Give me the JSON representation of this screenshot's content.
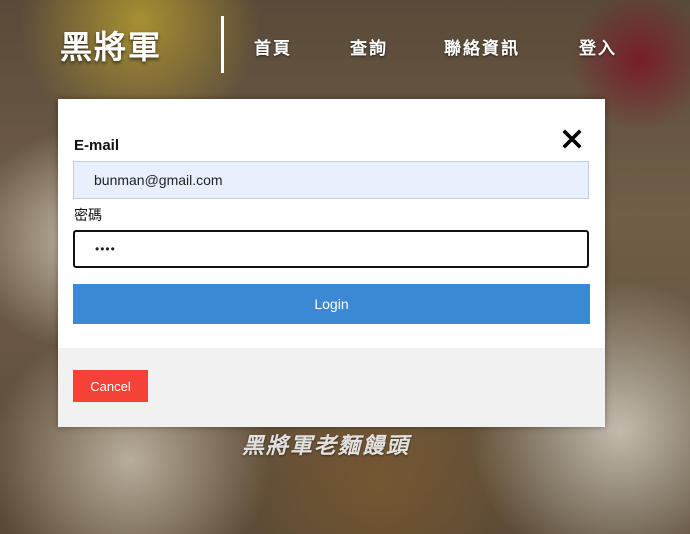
{
  "nav": {
    "brand": "黑將軍",
    "items": [
      {
        "label": "首頁"
      },
      {
        "label": "查詢"
      },
      {
        "label": "聯絡資訊"
      },
      {
        "label": "登入"
      }
    ]
  },
  "hero": {
    "watermark": "黑將軍老麵饅頭"
  },
  "login_modal": {
    "email_label": "E-mail",
    "email_value": "bunman@gmail.com",
    "password_label": "密碼",
    "password_value": "••••",
    "login_label": "Login",
    "cancel_label": "Cancel",
    "close_icon": "close-icon"
  },
  "colors": {
    "login_button": "#3b88d4",
    "cancel_button": "#f44336",
    "email_autofill_bg": "#e8f0fe",
    "footer_bg": "#f1f1f1"
  }
}
